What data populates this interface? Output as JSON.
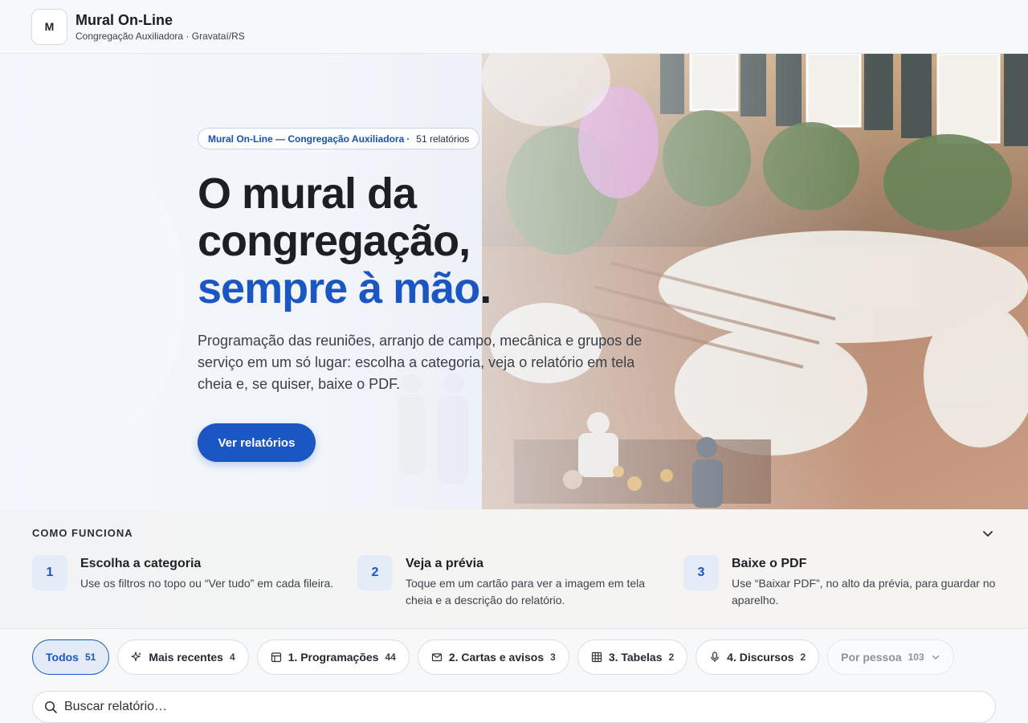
{
  "header": {
    "logo_letter": "M",
    "title": "Mural On-Line",
    "subtitle": "Congregação Auxiliadora · Gravataí/RS"
  },
  "hero": {
    "pill_name": "Mural On-Line — Congregação Auxiliadora",
    "pill_separator": "·",
    "pill_count": "51 relatórios",
    "title_line1": "O mural da",
    "title_line2": "congregação,",
    "title_accent": "sempre à mão",
    "title_end": ".",
    "description": "Programação das reuniões, arranjo de campo, mecânica e grupos de serviço em um só lugar: escolha a categoria, veja o relatório em tela cheia e, se quiser, baixe o PDF.",
    "cta_label": "Ver relatórios"
  },
  "how": {
    "title": "COMO FUNCIONA",
    "steps": [
      {
        "num": "1",
        "title": "Escolha a categoria",
        "desc": "Use os filtros no topo ou “Ver tudo” em cada fileira."
      },
      {
        "num": "2",
        "title": "Veja a prévia",
        "desc": "Toque em um cartão para ver a imagem em tela cheia e a descrição do relatório."
      },
      {
        "num": "3",
        "title": "Baixe o PDF",
        "desc": "Use “Baixar PDF”, no alto da prévia, para guardar no aparelho."
      }
    ]
  },
  "filters": {
    "chips": [
      {
        "label": "Todos",
        "count": "51",
        "icon": "none",
        "active": true
      },
      {
        "label": "Mais recentes",
        "count": "4",
        "icon": "sparkle-icon"
      },
      {
        "label": "1. Programações",
        "count": "44",
        "icon": "calendar-icon"
      },
      {
        "label": "2. Cartas e avisos",
        "count": "3",
        "icon": "mail-icon"
      },
      {
        "label": "3. Tabelas",
        "count": "2",
        "icon": "table-icon"
      },
      {
        "label": "4. Discursos",
        "count": "2",
        "icon": "microphone-icon"
      },
      {
        "label": "Por pessoa",
        "count": "103",
        "icon": "chevron-down-icon"
      }
    ],
    "search_placeholder": "Buscar relatório…"
  },
  "colors": {
    "accent": "#1a56c4",
    "text": "#1c1f24",
    "muted": "#8d929a"
  }
}
